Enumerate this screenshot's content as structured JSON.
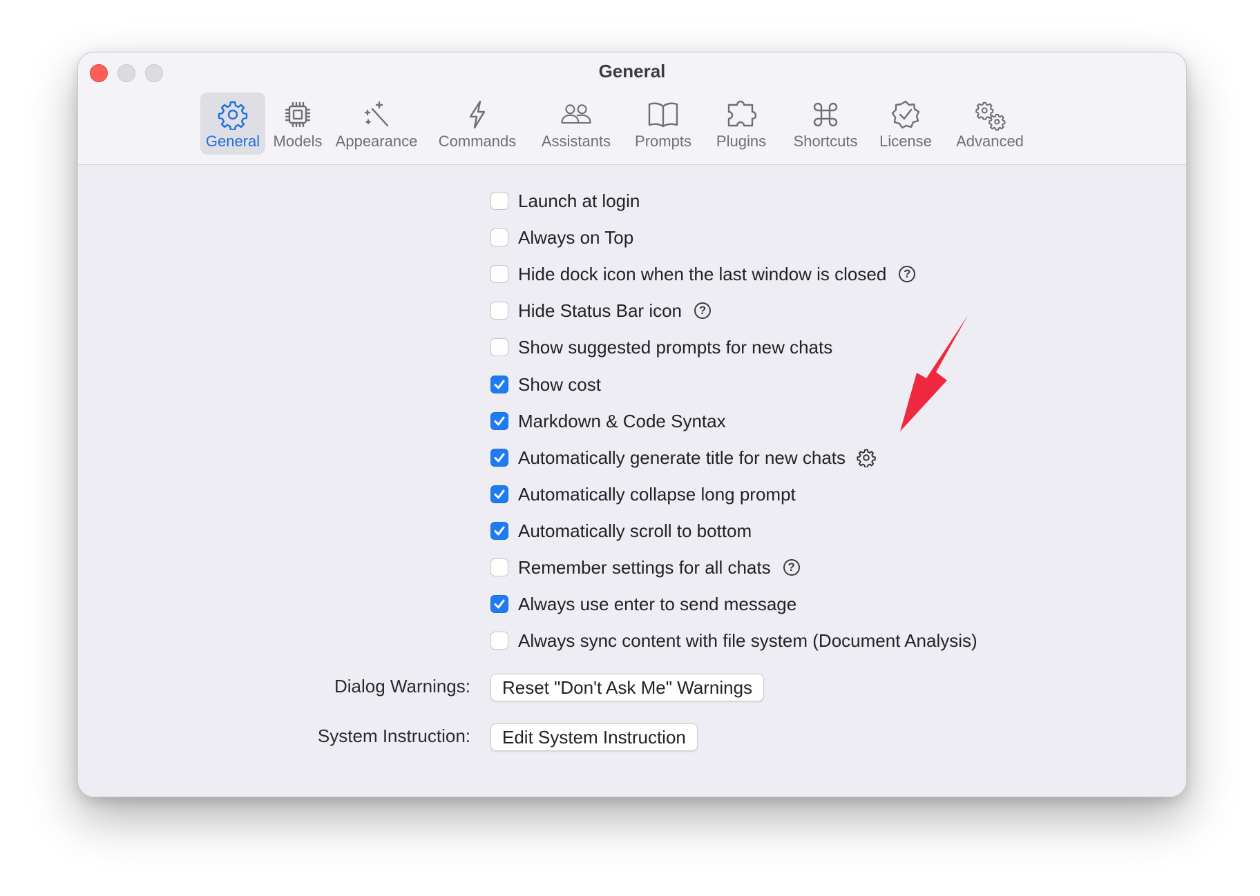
{
  "window": {
    "title": "General",
    "traffic_lights": [
      "close",
      "minimize",
      "zoom"
    ]
  },
  "toolbar": {
    "active_tab": "General",
    "accent_color": "#1f6fe0",
    "tabs": [
      {
        "label": "General",
        "icon": "gear-icon"
      },
      {
        "label": "Models",
        "icon": "chip-icon"
      },
      {
        "label": "Appearance",
        "icon": "magic-wand-icon"
      },
      {
        "label": "Commands",
        "icon": "bolt-icon"
      },
      {
        "label": "Assistants",
        "icon": "people-icon"
      },
      {
        "label": "Prompts",
        "icon": "book-icon"
      },
      {
        "label": "Plugins",
        "icon": "puzzle-icon"
      },
      {
        "label": "Shortcuts",
        "icon": "command-key-icon"
      },
      {
        "label": "License",
        "icon": "checkmark-seal-icon"
      },
      {
        "label": "Advanced",
        "icon": "gears-icon"
      }
    ]
  },
  "options": [
    {
      "label": "Launch at login",
      "checked": false
    },
    {
      "label": "Always on Top",
      "checked": false
    },
    {
      "label": "Hide dock icon when the last window is closed",
      "checked": false,
      "help": "?"
    },
    {
      "label": "Hide Status Bar icon",
      "checked": false,
      "help": "?"
    },
    {
      "label": "Show suggested prompts for new chats",
      "checked": false
    },
    {
      "label": "Show cost",
      "checked": true
    },
    {
      "label": "Markdown & Code Syntax",
      "checked": true
    },
    {
      "label": "Automatically generate title for new chats",
      "checked": true,
      "settings_icon": "gear-icon"
    },
    {
      "label": "Automatically collapse long prompt",
      "checked": true
    },
    {
      "label": "Automatically scroll to bottom",
      "checked": true
    },
    {
      "label": "Remember settings for all chats",
      "checked": false,
      "help": "?"
    },
    {
      "label": "Always use enter to send message",
      "checked": true
    },
    {
      "label": "Always sync content with file system (Document Analysis)",
      "checked": false
    }
  ],
  "dialog_warnings": {
    "label": "Dialog Warnings:",
    "button": "Reset \"Don't Ask Me\" Warnings"
  },
  "system_instruction": {
    "label": "System Instruction:",
    "button": "Edit System Instruction"
  },
  "annotation": {
    "icon": "red-arrow-icon",
    "color": "#f0283f"
  },
  "colors": {
    "checkbox_on": "#1e7bf2",
    "window_bg": "#eeedf3",
    "close_button": "#fd5e57"
  }
}
